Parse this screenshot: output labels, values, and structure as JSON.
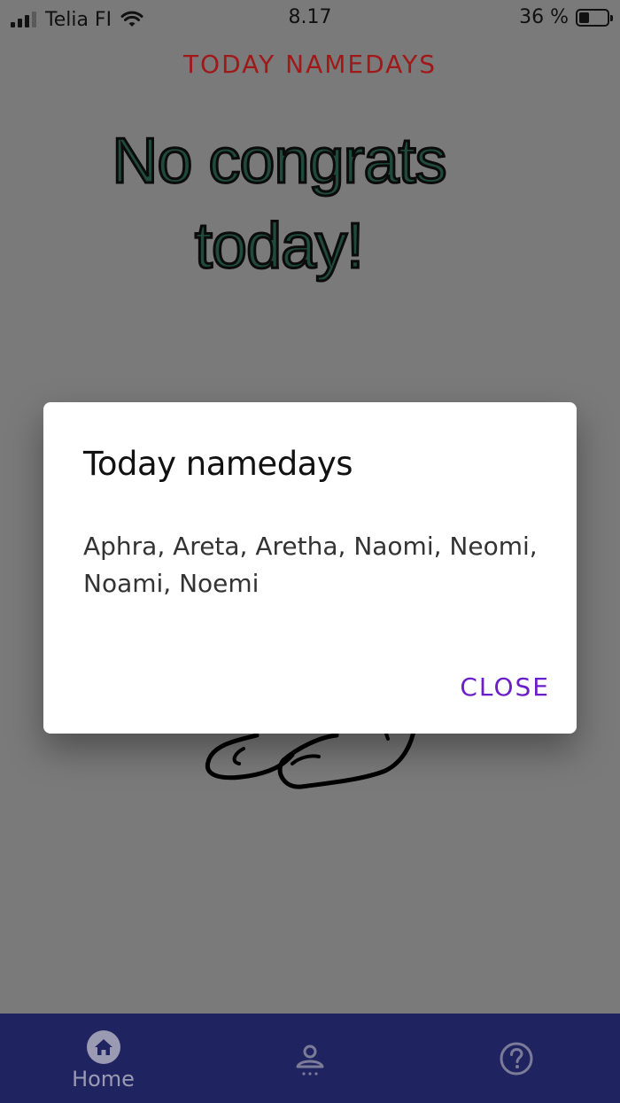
{
  "status_bar": {
    "carrier": "Telia FI",
    "time": "8.17",
    "battery_text": "36 %",
    "battery_level": 0.36
  },
  "header": {
    "title": "TODAY NAMEDAYS"
  },
  "main": {
    "message": "No congrats today!"
  },
  "dialog": {
    "title": "Today namedays",
    "names": "Aphra, Areta, Aretha, Naomi, Neomi, Noami, Noemi",
    "close_label": "CLOSE"
  },
  "bottom_nav": {
    "items": [
      {
        "label": "Home",
        "icon": "home-icon"
      },
      {
        "label": "",
        "icon": "profile-icon"
      },
      {
        "label": "",
        "icon": "help-icon"
      }
    ]
  },
  "colors": {
    "header_text": "#a01818",
    "accent": "#6a1ec8",
    "nav_background": "#1f2460",
    "overlay": "#7a7a7a"
  }
}
